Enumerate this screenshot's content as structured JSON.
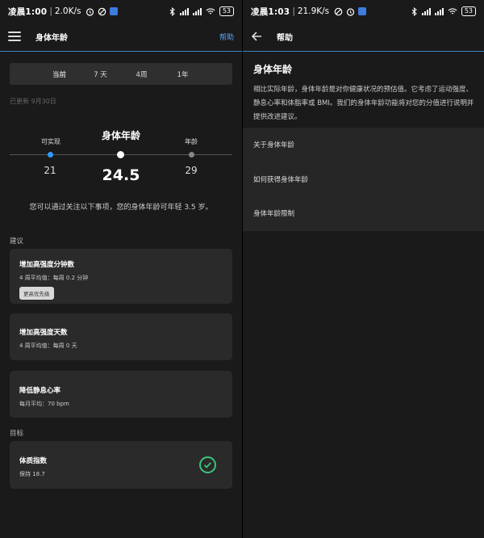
{
  "left": {
    "status": {
      "time": "凌晨1:00",
      "speed": "2.0K/s",
      "net": "HD 4G",
      "battery": "53"
    },
    "appbar": {
      "title": "身体年龄",
      "action": "帮助"
    },
    "tabs": [
      {
        "label": "当前",
        "active": true
      },
      {
        "label": "7 天"
      },
      {
        "label": "4周"
      },
      {
        "label": "1年"
      }
    ],
    "updated": "已更新 9月30日",
    "age": {
      "title": "身体年龄",
      "achievable_label": "可实现",
      "achievable_value": "21",
      "current_value": "24.5",
      "age_label": "年龄",
      "age_value": "29",
      "colors": {
        "achievable": "#2f9bff",
        "current": "#ffffff",
        "age": "#888888"
      }
    },
    "hint": "您可以通过关注以下事项，您的身体年龄可年轻 3.5 岁。",
    "suggestions_header": "建议",
    "suggestions": [
      {
        "title": "增加高强度分钟数",
        "subtitle": "4 周平均值：每周 0.2 分钟",
        "badge": "更高优先级"
      },
      {
        "title": "增加高强度天数",
        "subtitle": "4 周平均值：每周 0 天"
      },
      {
        "title": "降低静息心率",
        "subtitle": "每月平均：70 bpm"
      }
    ],
    "goals_header": "目标",
    "goal": {
      "title": "体质指数",
      "subtitle": "保持 18.7",
      "status_icon": "check-circle-icon"
    }
  },
  "right": {
    "status": {
      "time": "凌晨1:03",
      "speed": "21.9K/s",
      "net": "HD 4G",
      "battery": "53"
    },
    "appbar": {
      "title": "帮助"
    },
    "heading": "身体年龄",
    "paragraph": "相比实际年龄，身体年龄是对你健康状况的预估值。它考虑了运动强度、静息心率和体脂率或 BMI。我们的身体年龄功能将对您的分值进行说明并提供改进建议。",
    "items": [
      "关于身体年龄",
      "如何获得身体年龄",
      "身体年龄限制"
    ]
  }
}
